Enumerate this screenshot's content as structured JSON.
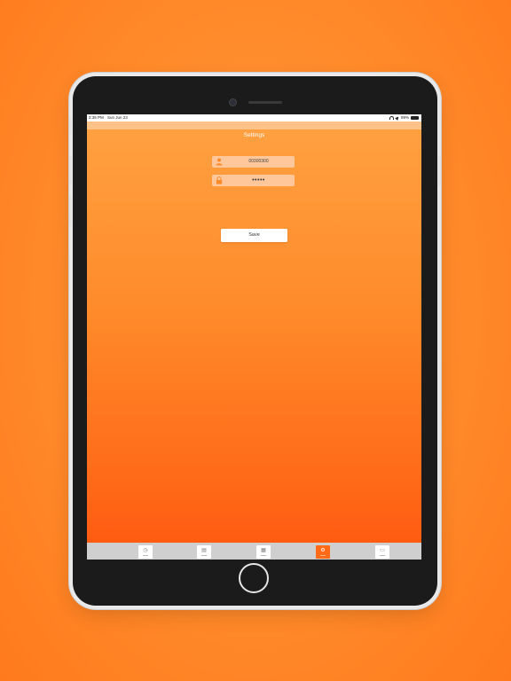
{
  "status_bar": {
    "time": "2:35 PM",
    "date": "Sun Jun 23",
    "battery": "99%"
  },
  "header": {
    "title": "Settings"
  },
  "form": {
    "username_value": "00300300",
    "password_value": "•••••",
    "save_label": "Save"
  },
  "tabbar": {
    "tabs": [
      {
        "icon": "clock-icon",
        "glyph": "◷"
      },
      {
        "icon": "document-icon",
        "glyph": "▤"
      },
      {
        "icon": "grid-icon",
        "glyph": "▦"
      },
      {
        "icon": "settings-icon",
        "glyph": "⚙",
        "active": true
      },
      {
        "icon": "qr-icon",
        "glyph": "▭"
      }
    ]
  },
  "colors": {
    "accent": "#ff6a18",
    "gradient_top": "#ffa040",
    "gradient_bottom": "#ff5c12",
    "field_bg": "#ffc79a"
  }
}
